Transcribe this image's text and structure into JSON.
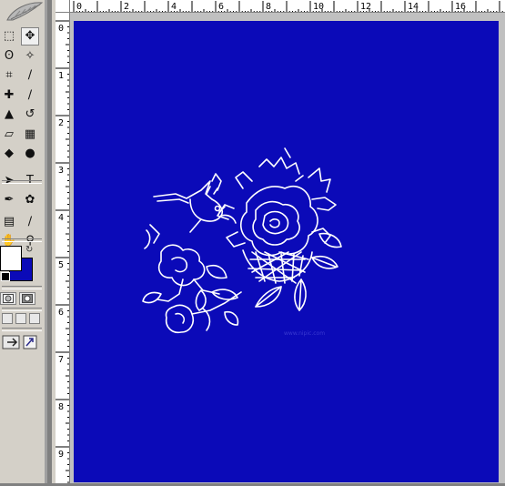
{
  "toolbox": {
    "tools": [
      {
        "name": "marquee-tool",
        "glyph": "⬚"
      },
      {
        "name": "move-tool",
        "glyph": "✥"
      },
      {
        "name": "lasso-tool",
        "glyph": "ʘ"
      },
      {
        "name": "magic-wand-tool",
        "glyph": "✧"
      },
      {
        "name": "crop-tool",
        "glyph": "⌗"
      },
      {
        "name": "slice-tool",
        "glyph": "∕"
      },
      {
        "name": "healing-brush-tool",
        "glyph": "✚"
      },
      {
        "name": "brush-tool",
        "glyph": "∕"
      },
      {
        "name": "clone-stamp-tool",
        "glyph": "▲"
      },
      {
        "name": "history-brush-tool",
        "glyph": "↺"
      },
      {
        "name": "eraser-tool",
        "glyph": "▱"
      },
      {
        "name": "gradient-tool",
        "glyph": "▦"
      },
      {
        "name": "blur-tool",
        "glyph": "◆"
      },
      {
        "name": "dodge-tool",
        "glyph": "●"
      },
      {
        "name": "path-selection-tool",
        "glyph": "➤"
      },
      {
        "name": "type-tool",
        "glyph": "T"
      },
      {
        "name": "pen-tool",
        "glyph": "✒"
      },
      {
        "name": "custom-shape-tool",
        "glyph": "✿"
      },
      {
        "name": "notes-tool",
        "glyph": "▤"
      },
      {
        "name": "eyedropper-tool",
        "glyph": "∕"
      },
      {
        "name": "hand-tool",
        "glyph": "✋"
      },
      {
        "name": "zoom-tool",
        "glyph": "⚲"
      }
    ],
    "foreground_color": "#ffffff",
    "background_color": "#0b0ab8"
  },
  "rulers": {
    "horizontal": [
      "0",
      "2",
      "4",
      "6",
      "8",
      "10",
      "12",
      "14",
      "16"
    ],
    "vertical": [
      "0",
      "1",
      "2",
      "3",
      "4",
      "5",
      "6",
      "7",
      "8",
      "9"
    ]
  },
  "document": {
    "canvas_color": "#0b0ab8",
    "artwork_color": "#ffffff",
    "watermark_text": "www.nipic.com"
  }
}
